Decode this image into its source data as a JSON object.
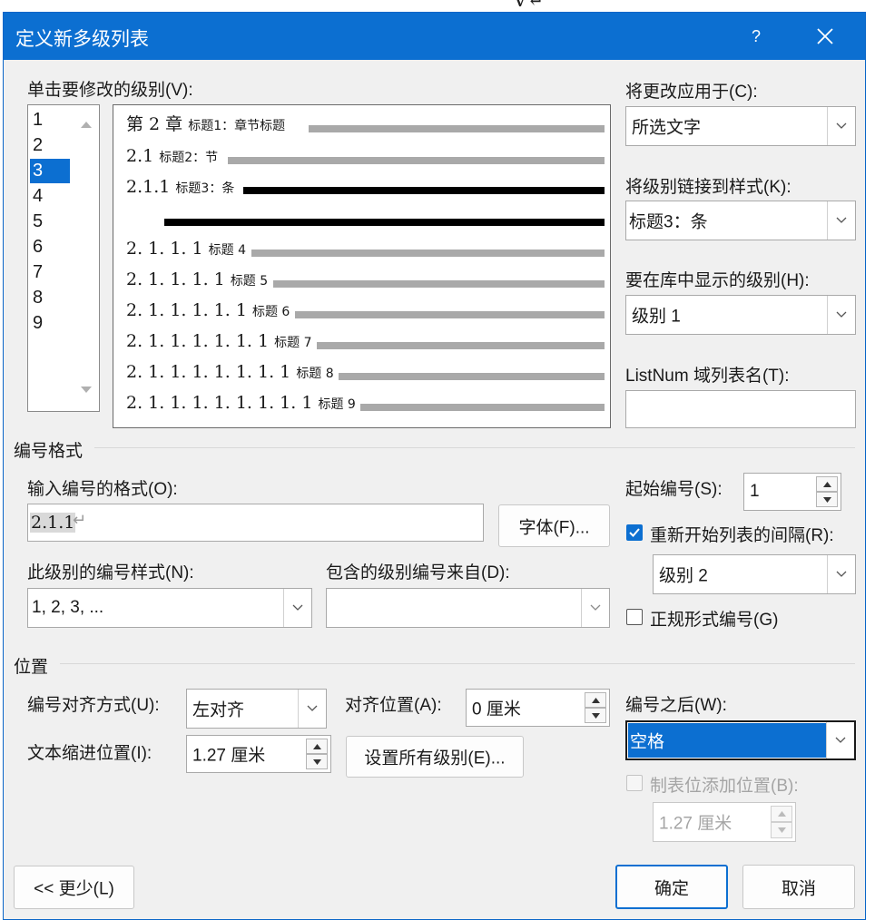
{
  "dialog": {
    "title": "定义新多级列表",
    "help": "?",
    "levels_label": "单击要修改的级别(V):",
    "levels": [
      "1",
      "2",
      "3",
      "4",
      "5",
      "6",
      "7",
      "8",
      "9"
    ],
    "selected_level": "3",
    "preview_rows": [
      {
        "num": "第 2 章",
        "style": "标题1：章节标题",
        "emphasis": false
      },
      {
        "num": "2.1",
        "style": "标题2：节",
        "emphasis": false
      },
      {
        "num": "2.1.1",
        "style": "标题3：条",
        "emphasis": true
      },
      {
        "num": "",
        "style": "",
        "emphasis": true
      },
      {
        "num": "2. 1. 1. 1",
        "style": "标题 4",
        "emphasis": false
      },
      {
        "num": "2. 1. 1. 1. 1",
        "style": "标题 5",
        "emphasis": false
      },
      {
        "num": "2. 1. 1. 1. 1. 1",
        "style": "标题 6",
        "emphasis": false
      },
      {
        "num": "2. 1. 1. 1. 1. 1. 1",
        "style": "标题 7",
        "emphasis": false
      },
      {
        "num": "2. 1. 1. 1. 1. 1. 1. 1",
        "style": "标题 8",
        "emphasis": false
      },
      {
        "num": "2. 1. 1. 1. 1. 1. 1. 1. 1",
        "style": "标题 9",
        "emphasis": false
      }
    ],
    "apply_to_label": "将更改应用于(C):",
    "apply_to_value": "所选文字",
    "link_style_label": "将级别链接到样式(K):",
    "link_style_value": "标题3：条",
    "gallery_level_label": "要在库中显示的级别(H):",
    "gallery_level_value": "级别 1",
    "listnum_label": "ListNum 域列表名(T):",
    "listnum_value": "",
    "section_format": "编号格式",
    "format_label": "输入编号的格式(O):",
    "format_value": "2.1.1",
    "font_button": "字体(F)...",
    "number_style_label": "此级别的编号样式(N):",
    "number_style_value": "1, 2, 3, ...",
    "include_from_label": "包含的级别编号来自(D):",
    "include_from_value": "",
    "start_at_label": "起始编号(S):",
    "start_at_value": "1",
    "restart_label": "重新开始列表的间隔(R):",
    "restart_checked": true,
    "restart_value": "级别 2",
    "legal_label": "正规形式编号(G)",
    "legal_checked": false,
    "section_position": "位置",
    "align_label": "编号对齐方式(U):",
    "align_value": "左对齐",
    "align_at_label": "对齐位置(A):",
    "align_at_value": "0 厘米",
    "indent_label": "文本缩进位置(I):",
    "indent_value": "1.27 厘米",
    "set_all_button": "设置所有级别(E)...",
    "follow_label": "编号之后(W):",
    "follow_value": "空格",
    "tab_stop_label": "制表位添加位置(B):",
    "tab_stop_checked": false,
    "tab_stop_value": "1.27 厘米",
    "less_button": "<< 更少(L)",
    "ok_button": "确定",
    "cancel_button": "取消"
  },
  "background": {
    "frag_top": "V↵"
  },
  "colors": {
    "accent": "#0c6fd1",
    "selection": "#0c6fd1",
    "dialog_bg": "#f0f0f0"
  }
}
